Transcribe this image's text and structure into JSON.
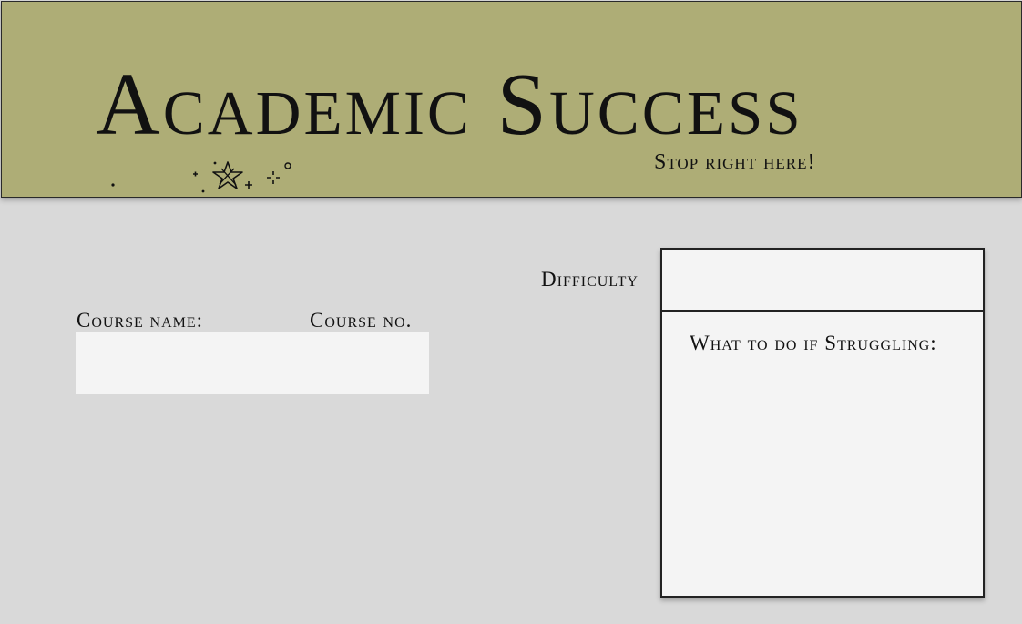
{
  "header": {
    "title": "Academic Success",
    "tagline": "Stop right here!",
    "decoration": "star-sparkles-icon"
  },
  "course": {
    "name_label": "Course name:",
    "number_label": "Course no."
  },
  "difficulty": {
    "label": "Difficulty"
  },
  "struggle_card": {
    "heading": "What to do if Struggling:"
  },
  "colors": {
    "banner": "#aead76",
    "background": "#d9d9d9",
    "field": "#f4f4f4",
    "text": "#111111"
  }
}
